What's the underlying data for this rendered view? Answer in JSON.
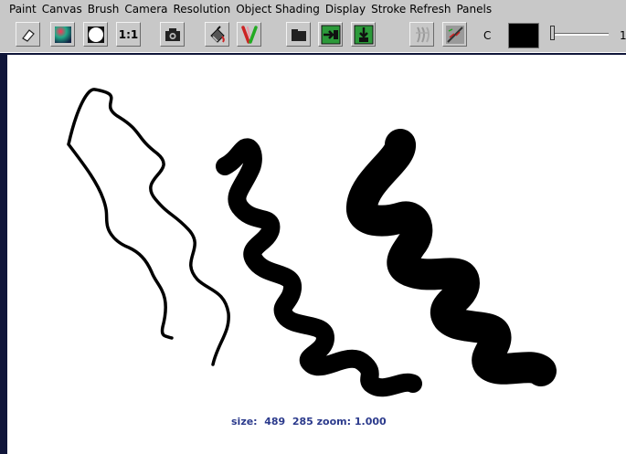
{
  "menu": [
    "Paint",
    "Canvas",
    "Brush",
    "Camera",
    "Resolution",
    "Object Shading",
    "Display",
    "Stroke Refresh",
    "Panels"
  ],
  "toolbar": {
    "buttons": [
      {
        "name": "eraser-button",
        "icon": "eraser-icon"
      },
      {
        "name": "color-sphere-button",
        "icon": "color-sphere-icon"
      },
      {
        "name": "white-circle-button",
        "icon": "circle-icon"
      },
      {
        "name": "one-to-one-button",
        "icon": "ratio-icon",
        "label": "1:1"
      },
      {
        "name": "snapshot-button",
        "icon": "camera-icon"
      },
      {
        "name": "brush-tool-button",
        "icon": "paint-bucket-icon"
      },
      {
        "name": "brush-style-button",
        "icon": "brush-v-icon"
      },
      {
        "name": "open-folder-button",
        "icon": "folder-icon"
      },
      {
        "name": "import-button",
        "icon": "import-arrow-icon"
      },
      {
        "name": "export-button",
        "icon": "export-arrow-icon"
      },
      {
        "name": "wiggle-button",
        "icon": "wiggle-icon"
      },
      {
        "name": "diagonal-button",
        "icon": "diagonal-icon"
      }
    ],
    "color_label": "C",
    "color": "#000000",
    "slider_value": "1"
  },
  "canvas": {
    "status": "size:  489  285 zoom: 1.000"
  }
}
